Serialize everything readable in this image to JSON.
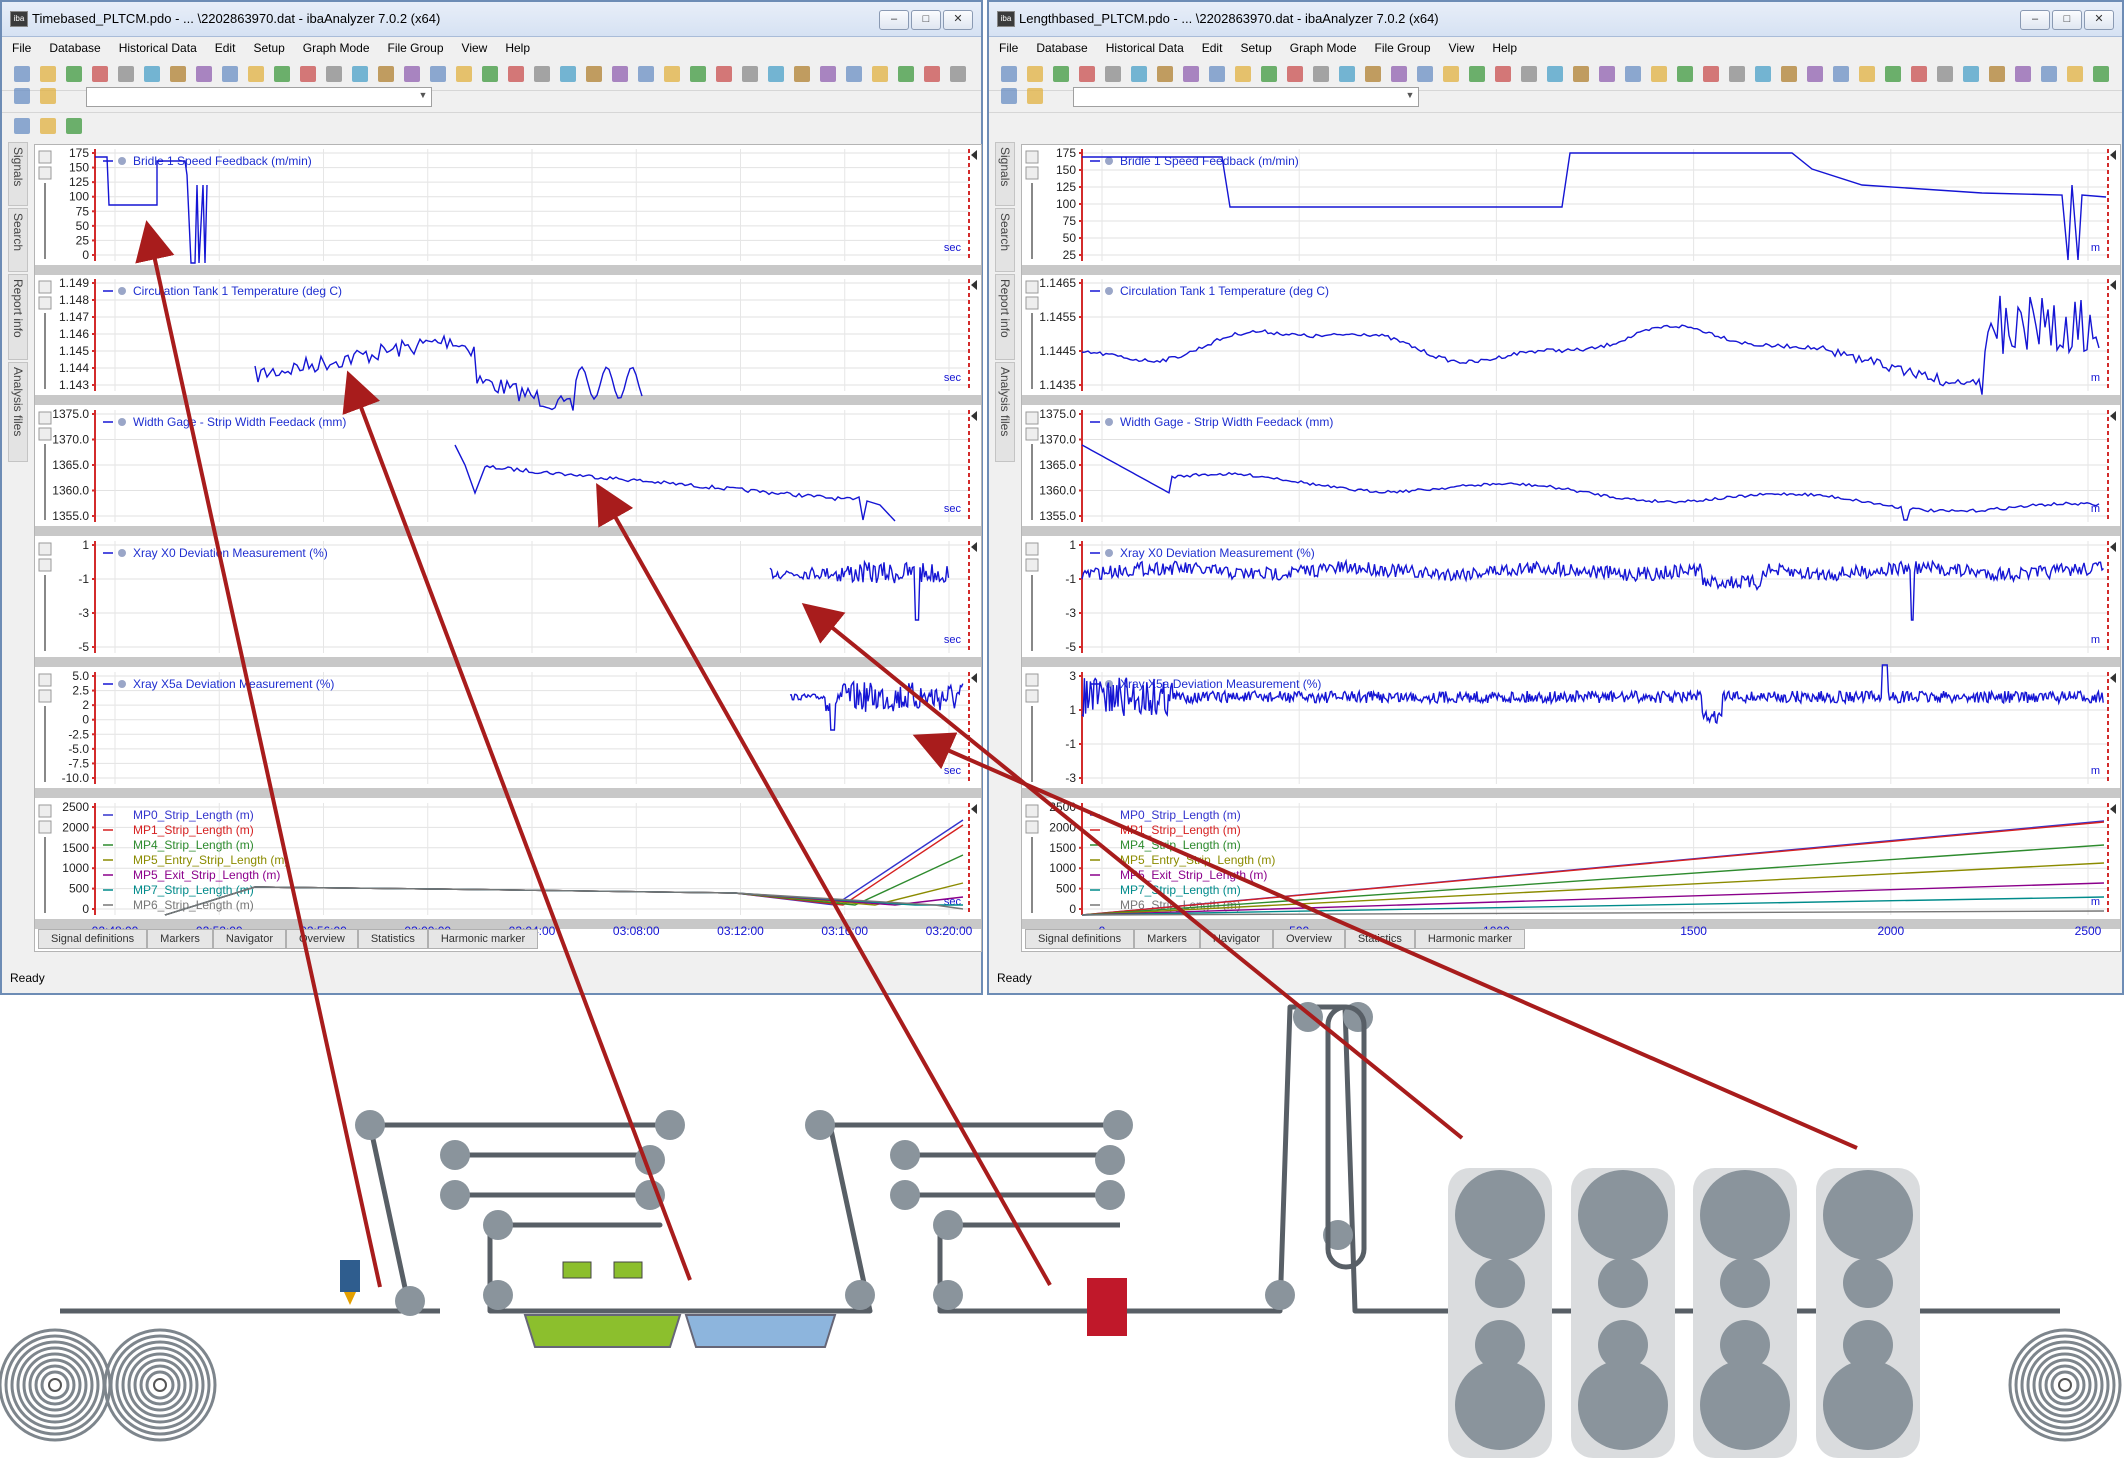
{
  "windows": [
    {
      "title": "Timebased_PLTCM.pdo - ... \\2202863970.dat - ibaAnalyzer 7.0.2 (x64)",
      "menu": [
        "File",
        "Database",
        "Historical Data",
        "Edit",
        "Setup",
        "Graph Mode",
        "File Group",
        "View",
        "Help"
      ],
      "side_tabs": [
        "Signals",
        "Search",
        "Report info",
        "Analysis files"
      ],
      "bottom_tabs": [
        "Signal definitions",
        "Markers",
        "Navigator",
        "Overview",
        "Statistics",
        "Harmonic marker"
      ],
      "status": "Ready",
      "x_unit": "sec",
      "x_ticks": [
        "02:48:00",
        "02:52:00",
        "02:56:00",
        "03:00:00",
        "03:04:00",
        "03:08:00",
        "03:12:00",
        "03:16:00",
        "03:20:00"
      ],
      "panels": [
        {
          "title": "Bridle 1 Speed Feedback (m/min)",
          "y_ticks": [
            "175",
            "150",
            "125",
            "100",
            "75",
            "50",
            "25",
            "0"
          ]
        },
        {
          "title": "Circulation Tank 1 Temperature (deg C)",
          "y_ticks": [
            "1.149",
            "1.148",
            "1.147",
            "1.146",
            "1.145",
            "1.144",
            "1.143"
          ]
        },
        {
          "title": "Width Gage - Strip Width Feedack (mm)",
          "y_ticks": [
            "1375.0",
            "1370.0",
            "1365.0",
            "1360.0",
            "1355.0"
          ]
        },
        {
          "title": "Xray X0 Deviation Measurement (%)",
          "y_ticks": [
            "1",
            "-1",
            "-3",
            "-5"
          ]
        },
        {
          "title": "Xray X5a Deviation Measurement (%)",
          "y_ticks": [
            "5.0",
            "2.5",
            "2",
            "0",
            "-2.5",
            "-5.0",
            "-7.5",
            "-10.0"
          ]
        },
        {
          "title": "",
          "y_ticks": [
            "2500",
            "2000",
            "1500",
            "1000",
            "500",
            "0"
          ],
          "legend": [
            "MP0_Strip_Length (m)",
            "MP1_Strip_Length (m)",
            "MP4_Strip_Length (m)",
            "MP5_Entry_Strip_Length (m)",
            "MP5_Exit_Strip_Length (m)",
            "MP7_Strip_Length (m)",
            "MP6_Strip_Length (m)"
          ]
        }
      ]
    },
    {
      "title": "Lengthbased_PLTCM.pdo - ... \\2202863970.dat - ibaAnalyzer 7.0.2 (x64)",
      "menu": [
        "File",
        "Database",
        "Historical Data",
        "Edit",
        "Setup",
        "Graph Mode",
        "File Group",
        "View",
        "Help"
      ],
      "side_tabs": [
        "Signals",
        "Search",
        "Report info",
        "Analysis files"
      ],
      "bottom_tabs": [
        "Signal definitions",
        "Markers",
        "Navigator",
        "Overview",
        "Statistics",
        "Harmonic marker"
      ],
      "status": "Ready",
      "x_unit": "m",
      "x_ticks": [
        "0",
        "500",
        "1000",
        "1500",
        "2000",
        "2500"
      ],
      "panels": [
        {
          "title": "Bridle 1 Speed Feedback (m/min)",
          "y_ticks": [
            "175",
            "150",
            "125",
            "100",
            "75",
            "50",
            "25"
          ]
        },
        {
          "title": "Circulation Tank 1 Temperature (deg C)",
          "y_ticks": [
            "1.1465",
            "1.1455",
            "1.1445",
            "1.1435"
          ]
        },
        {
          "title": "Width Gage - Strip Width Feedack (mm)",
          "y_ticks": [
            "1375.0",
            "1370.0",
            "1365.0",
            "1360.0",
            "1355.0"
          ]
        },
        {
          "title": "Xray X0 Deviation Measurement (%)",
          "y_ticks": [
            "1",
            "-1",
            "-3",
            "-5"
          ]
        },
        {
          "title": "Xray X5a Deviation Measurement (%)",
          "y_ticks": [
            "3",
            "1",
            "-1",
            "-3"
          ]
        },
        {
          "title": "",
          "y_ticks": [
            "2500",
            "2000",
            "1500",
            "1000",
            "500",
            "0"
          ],
          "legend": [
            "MP0_Strip_Length (m)",
            "MP1_Strip_Length (m)",
            "MP4_Strip_Length (m)",
            "MP5_Entry_Strip_Length (m)",
            "MP5_Exit_Strip_Length (m)",
            "MP7_Strip_Length (m)",
            "MP6_Strip_Length (m)"
          ]
        }
      ]
    }
  ],
  "colors": {
    "signal": "#1515d4",
    "marker": "#d32b2b",
    "arrow": "#a81c1c",
    "roll": "#8a949c",
    "belt": "#585f66",
    "green_tank": "#8cbf2d",
    "blue_tank": "#8db5dd",
    "gauge": "#c0182a",
    "stand_bg": "#dadcde"
  },
  "legend_colors": [
    "#3333cc",
    "#d62020",
    "#2e8b2e",
    "#8b8b00",
    "#8b008b",
    "#008b8b",
    "#777777"
  ]
}
